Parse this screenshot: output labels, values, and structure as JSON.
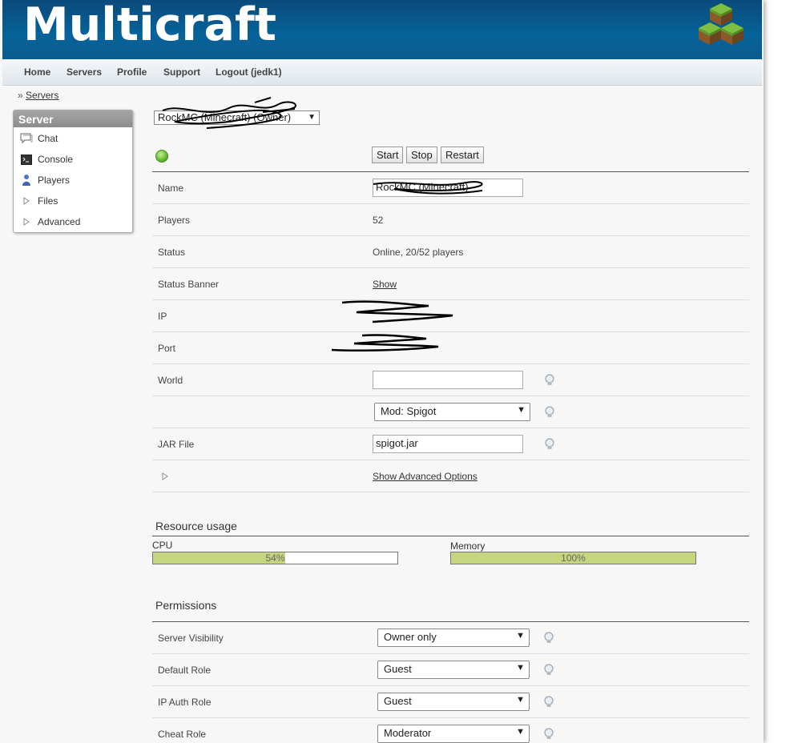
{
  "header": {
    "logo": "Multicraft",
    "logo_icon": "grass-cubes-icon"
  },
  "nav": {
    "items": [
      "Home",
      "Servers",
      "Profile",
      "Support",
      "Logout (jedk1)"
    ]
  },
  "breadcrumb": {
    "prefix": "»",
    "link": "Servers"
  },
  "sidebar": {
    "title": "Server",
    "items": [
      {
        "label": "Chat",
        "icon": "chat-icon"
      },
      {
        "label": "Console",
        "icon": "console-icon"
      },
      {
        "label": "Players",
        "icon": "player-icon"
      },
      {
        "label": "Files",
        "icon": "expand-triangle-icon"
      },
      {
        "label": "Advanced",
        "icon": "expand-triangle-icon"
      }
    ]
  },
  "server_select": {
    "value": "RockMC (Minecraft) (Owner)"
  },
  "controls": {
    "start": "Start",
    "stop": "Stop",
    "restart": "Restart"
  },
  "server": {
    "name_label": "Name",
    "name_value": "RockMC (Minecraft)",
    "players_label": "Players",
    "players_value": "52",
    "status_label": "Status",
    "status_value": "Online, 20/52 players",
    "banner_label": "Status Banner",
    "banner_link": "Show",
    "ip_label": "IP",
    "port_label": "Port",
    "world_label": "World",
    "world_value": "",
    "mod_value": "Mod: Spigot",
    "jar_label": "JAR File",
    "jar_value": "spigot.jar",
    "advanced_link": "Show Advanced Options"
  },
  "resources": {
    "title": "Resource usage",
    "cpu_label": "CPU",
    "cpu_text": "54%",
    "cpu_percent": 54,
    "memory_label": "Memory",
    "memory_text": "100%",
    "memory_percent": 100,
    "bar_color": "#c5d67e"
  },
  "permissions": {
    "title": "Permissions",
    "rows": [
      {
        "label": "Server Visibility",
        "value": "Owner only"
      },
      {
        "label": "Default Role",
        "value": "Guest"
      },
      {
        "label": "IP Auth Role",
        "value": "Guest"
      },
      {
        "label": "Cheat Role",
        "value": "Moderator"
      }
    ]
  }
}
